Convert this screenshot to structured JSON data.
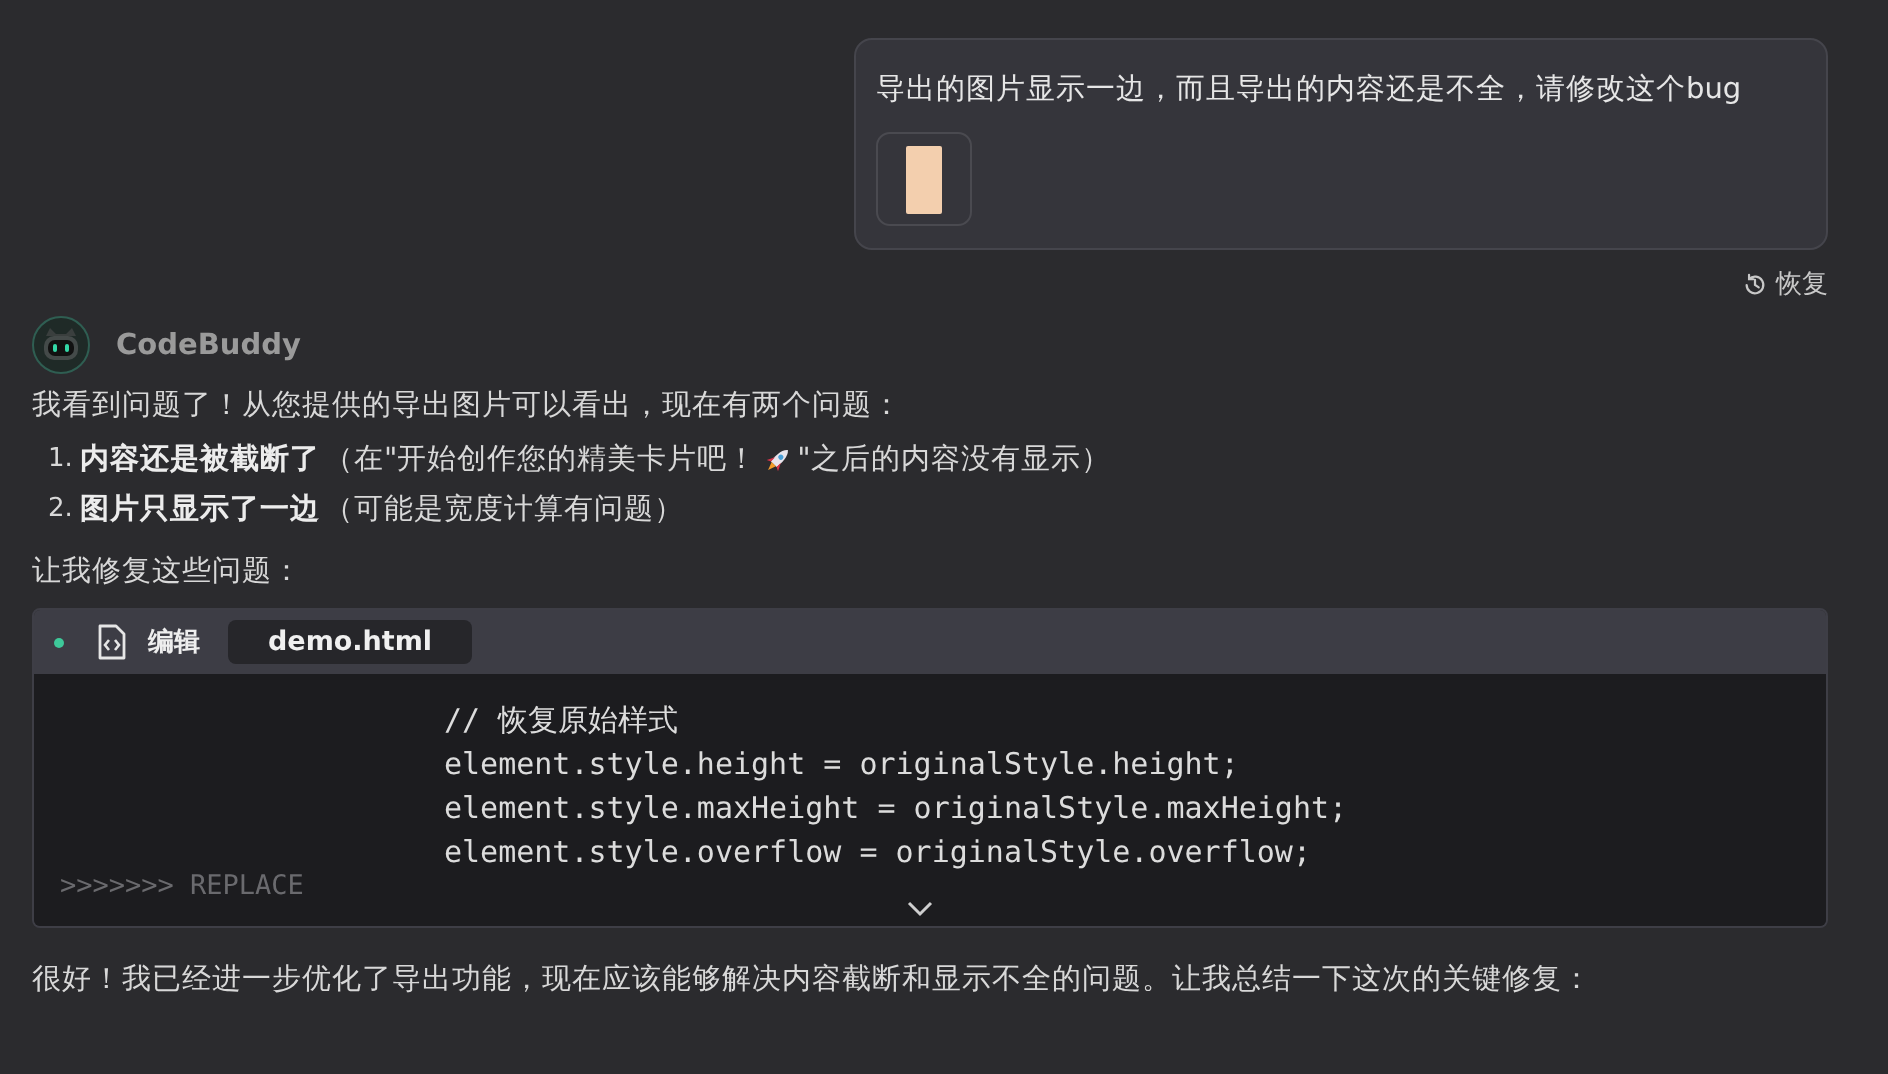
{
  "user_message": {
    "text": "导出的图片显示一边，而且导出的内容还是不全，请修改这个bug",
    "has_attachment": true
  },
  "restore": {
    "label": "恢复"
  },
  "assistant": {
    "name": "CodeBuddy",
    "intro": "我看到问题了！从您提供的导出图片可以看出，现在有两个问题：",
    "issues": [
      {
        "number": "1.",
        "bold": "内容还是被截断了",
        "segments": [
          {
            "kind": "text",
            "text": "（在\"开始创作您的精美卡片吧！"
          },
          {
            "kind": "rocket"
          },
          {
            "kind": "text",
            "text": "\"之后的内容没有显示）"
          }
        ]
      },
      {
        "number": "2.",
        "bold": "图片只显示了一边",
        "segments": [
          {
            "kind": "text",
            "text": "（可能是宽度计算有问题）"
          }
        ]
      }
    ],
    "lead": "让我修复这些问题：",
    "edit_block": {
      "action": "编辑",
      "file": "demo.html",
      "lines": [
        {
          "text": "// 恢复原始样式"
        },
        {
          "text": "element.style.height = originalStyle.height;"
        },
        {
          "text": "element.style.maxHeight = originalStyle.maxHeight;"
        },
        {
          "text": "element.style.overflow = originalStyle.overflow;"
        }
      ],
      "marker": ">>>>>>> REPLACE"
    },
    "closing": "很好！我已经进一步优化了导出功能，现在应该能够解决内容截断和显示不全的问题。让我总结一下这次的关键修复："
  }
}
